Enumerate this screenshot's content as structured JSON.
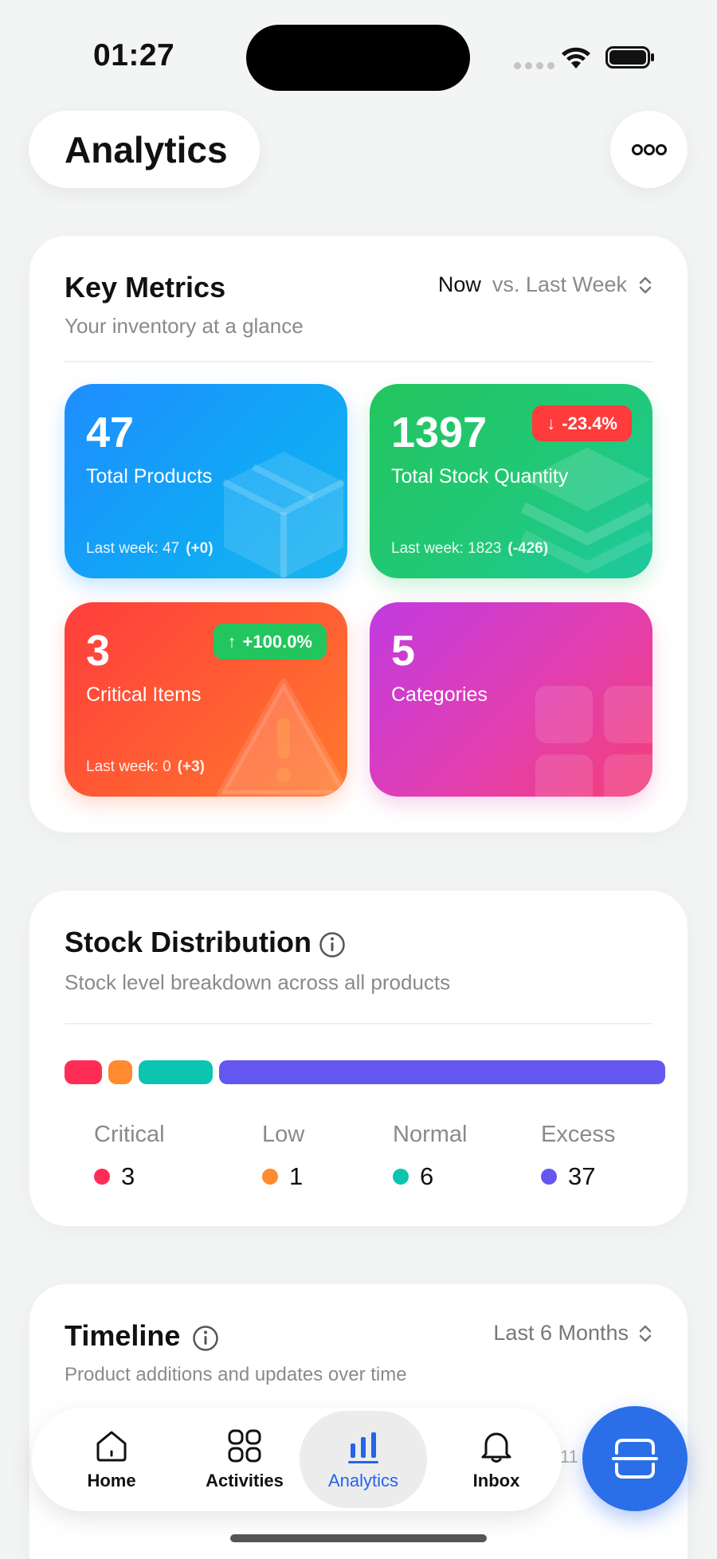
{
  "status_bar": {
    "time": "01:27"
  },
  "header": {
    "title": "Analytics",
    "more_icon": "ellipsis-icon"
  },
  "key_metrics": {
    "title": "Key Metrics",
    "subtitle": "Your inventory at a glance",
    "period_now": "Now",
    "period_compare": "vs. Last Week",
    "tiles": [
      {
        "value": "47",
        "label": "Total Products",
        "last_week": "Last week: 47",
        "delta": "(+0)",
        "badge": "",
        "color": "#1f8dff",
        "icon": "box-icon"
      },
      {
        "value": "1397",
        "label": "Total Stock Quantity",
        "last_week": "Last week: 1823",
        "delta": "(-426)",
        "badge": "-23.4%",
        "badge_color": "#ff3b3b",
        "color": "#22c55e",
        "icon": "layers-icon"
      },
      {
        "value": "3",
        "label": "Critical Items",
        "last_week": "Last week: 0",
        "delta": "(+3)",
        "badge": "+100.0%",
        "badge_color": "#22c55e",
        "color": "#ff4d3a",
        "icon": "warning-icon"
      },
      {
        "value": "5",
        "label": "Categories",
        "last_week": "",
        "delta": "",
        "badge": "",
        "color": "#d63fc0",
        "icon": "grid-icon"
      }
    ]
  },
  "stock_distribution": {
    "title": "Stock Distribution",
    "subtitle": "Stock level breakdown across all products",
    "levels": [
      {
        "label": "Critical",
        "count": "3",
        "color": "#ff2d55"
      },
      {
        "label": "Low",
        "count": "1",
        "color": "#ff8a30"
      },
      {
        "label": "Normal",
        "count": "6",
        "color": "#0cc4b0"
      },
      {
        "label": "Excess",
        "count": "37",
        "color": "#6357f0"
      }
    ]
  },
  "timeline": {
    "title": "Timeline",
    "subtitle": "Product additions and updates over time",
    "range": "Last 6 Months",
    "partial_value": "11"
  },
  "tabbar": {
    "tabs": [
      {
        "label": "Home",
        "icon": "house-icon"
      },
      {
        "label": "Activities",
        "icon": "grid-icon"
      },
      {
        "label": "Analytics",
        "icon": "bar-chart-icon"
      },
      {
        "label": "Inbox",
        "icon": "bell-icon"
      }
    ],
    "active": "Analytics",
    "fab_icon": "scan-icon",
    "accent": "#2563eb"
  }
}
